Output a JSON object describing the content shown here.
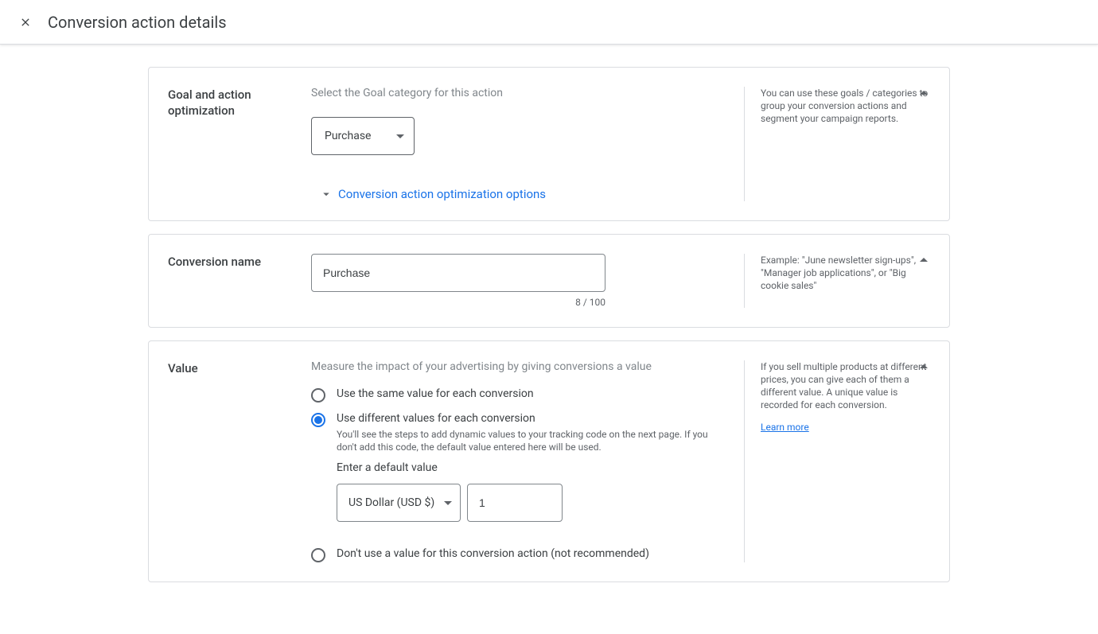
{
  "header": {
    "title": "Conversion action details"
  },
  "goal_section": {
    "title": "Goal and action optimization",
    "hint": "Select the Goal category for this action",
    "selected": "Purchase",
    "expand_label": "Conversion action optimization options",
    "help": "You can use these goals / categories to group your conversion actions and segment your campaign reports."
  },
  "name_section": {
    "title": "Conversion name",
    "value": "Purchase",
    "counter": "8 / 100",
    "help": "Example: \"June newsletter sign-ups\", \"Manager job applications\", or \"Big cookie sales\""
  },
  "value_section": {
    "title": "Value",
    "hint": "Measure the impact of your advertising by giving conversions a value",
    "opt_same": "Use the same value for each conversion",
    "opt_diff": "Use different values for each conversion",
    "opt_diff_sub": "You'll see the steps to add dynamic values to your tracking code on the next page. If you don't add this code, the default value entered here will be used.",
    "default_label": "Enter a default value",
    "currency": "US Dollar (USD $)",
    "default_value": "1",
    "opt_none": "Don't use a value for this conversion action (not recommended)",
    "help": "If you sell multiple products at different prices, you can give each of them a different value. A unique value is recorded for each conversion.",
    "learn_more": "Learn more"
  }
}
